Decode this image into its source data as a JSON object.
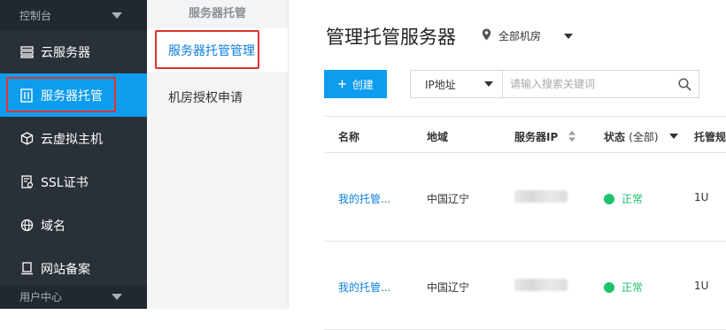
{
  "sidebar": {
    "header": "控制台",
    "items": [
      {
        "label": "云服务器",
        "icon": "server-list-icon"
      },
      {
        "label": "服务器托管",
        "icon": "server-hosting-icon",
        "active": true
      },
      {
        "label": "云虚拟主机",
        "icon": "cube-icon"
      },
      {
        "label": "SSL证书",
        "icon": "certificate-icon"
      },
      {
        "label": "域名",
        "icon": "globe-icon"
      },
      {
        "label": "网站备案",
        "icon": "filing-icon"
      }
    ],
    "footer": "用户中心"
  },
  "subnav": {
    "title": "服务器托管",
    "items": [
      {
        "label": "服务器托管管理",
        "active": true
      },
      {
        "label": "机房授权申请"
      }
    ]
  },
  "main": {
    "title": "管理托管服务器",
    "region": "全部机房",
    "create_label": "创建",
    "search": {
      "select_value": "IP地址",
      "placeholder": "请输入搜索关键词"
    },
    "table": {
      "headers": {
        "name": "名称",
        "region": "地域",
        "ip": "服务器IP",
        "status": "状态",
        "status_filter": "(全部)",
        "spec": "托管规"
      },
      "rows": [
        {
          "name": "我的托管...",
          "region": "中国辽宁",
          "status": "正常",
          "spec": "1U"
        },
        {
          "name": "我的托管...",
          "region": "中国辽宁",
          "status": "正常",
          "spec": "1U"
        }
      ]
    }
  },
  "colors": {
    "accent": "#0e9cee",
    "sidebar_bg": "#293038",
    "status_ok": "#1ec26a",
    "highlight": "#e0322f"
  }
}
